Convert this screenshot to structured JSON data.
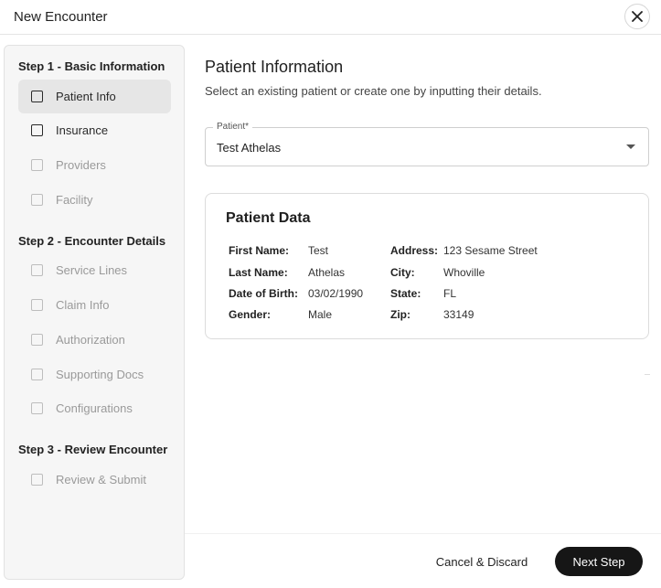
{
  "header": {
    "title": "New Encounter",
    "close_icon": "close-icon"
  },
  "sidebar": {
    "step1_heading": "Step 1 - Basic Information",
    "step2_heading": "Step 2 - Encounter Details",
    "step3_heading": "Step 3 - Review Encounter",
    "items": [
      {
        "label": "Patient Info",
        "active": true,
        "enabled": true
      },
      {
        "label": "Insurance",
        "active": false,
        "enabled": true
      },
      {
        "label": "Providers",
        "active": false,
        "enabled": false
      },
      {
        "label": "Facility",
        "active": false,
        "enabled": false
      },
      {
        "label": "Service Lines",
        "active": false,
        "enabled": false
      },
      {
        "label": "Claim Info",
        "active": false,
        "enabled": false
      },
      {
        "label": "Authorization",
        "active": false,
        "enabled": false
      },
      {
        "label": "Supporting Docs",
        "active": false,
        "enabled": false
      },
      {
        "label": "Configurations",
        "active": false,
        "enabled": false
      },
      {
        "label": "Review & Submit",
        "active": false,
        "enabled": false
      }
    ]
  },
  "main": {
    "title": "Patient Information",
    "subtitle": "Select an existing patient or create one by inputting their details.",
    "patient_select": {
      "label": "Patient*",
      "value": "Test Athelas"
    },
    "patient_card": {
      "title": "Patient Data",
      "fields": {
        "first_name_label": "First Name:",
        "first_name": "Test",
        "last_name_label": "Last Name:",
        "last_name": "Athelas",
        "dob_label": "Date of Birth:",
        "dob": "03/02/1990",
        "gender_label": "Gender:",
        "gender": "Male",
        "address_label": "Address:",
        "address": "123 Sesame Street",
        "city_label": "City:",
        "city": "Whoville",
        "state_label": "State:",
        "state": "FL",
        "zip_label": "Zip:",
        "zip": "33149"
      }
    }
  },
  "footer": {
    "cancel_label": "Cancel & Discard",
    "next_label": "Next Step"
  }
}
